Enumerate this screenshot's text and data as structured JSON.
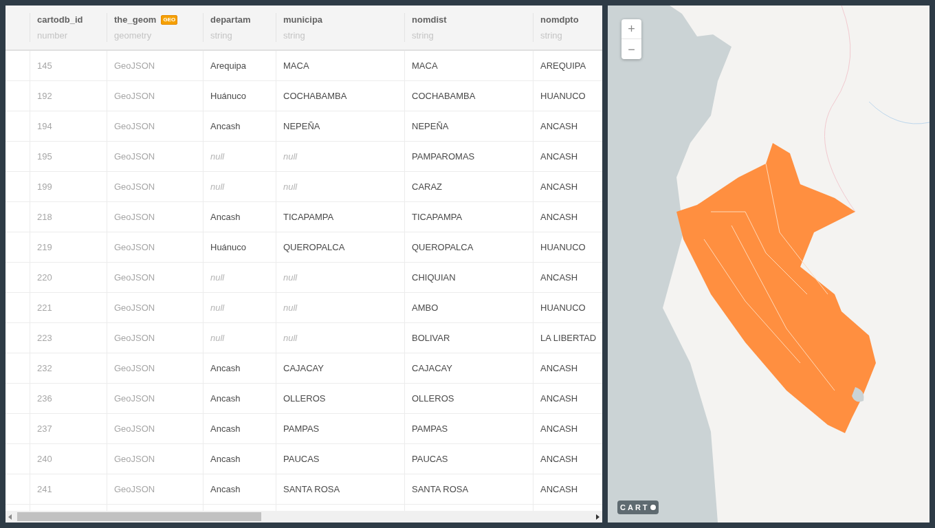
{
  "table": {
    "columns": [
      {
        "name": "cartodb_id",
        "type": "number"
      },
      {
        "name": "the_geom",
        "type": "geometry",
        "badge": "GEO"
      },
      {
        "name": "departam",
        "type": "string"
      },
      {
        "name": "municipa",
        "type": "string"
      },
      {
        "name": "nomdist",
        "type": "string"
      },
      {
        "name": "nomdpto",
        "type": "string"
      }
    ],
    "rows": [
      [
        {
          "text": "145",
          "kind": "number"
        },
        {
          "text": "GeoJSON",
          "kind": "geometry"
        },
        {
          "text": "Arequipa",
          "kind": "string"
        },
        {
          "text": "MACA",
          "kind": "string"
        },
        {
          "text": "MACA",
          "kind": "string"
        },
        {
          "text": "AREQUIPA",
          "kind": "string"
        }
      ],
      [
        {
          "text": "192",
          "kind": "number"
        },
        {
          "text": "GeoJSON",
          "kind": "geometry"
        },
        {
          "text": "Huánuco",
          "kind": "string"
        },
        {
          "text": "COCHABAMBA",
          "kind": "string"
        },
        {
          "text": "COCHABAMBA",
          "kind": "string"
        },
        {
          "text": "HUANUCO",
          "kind": "string"
        }
      ],
      [
        {
          "text": "194",
          "kind": "number"
        },
        {
          "text": "GeoJSON",
          "kind": "geometry"
        },
        {
          "text": "Ancash",
          "kind": "string"
        },
        {
          "text": "NEPEÑA",
          "kind": "string"
        },
        {
          "text": "NEPEÑA",
          "kind": "string"
        },
        {
          "text": "ANCASH",
          "kind": "string"
        }
      ],
      [
        {
          "text": "195",
          "kind": "number"
        },
        {
          "text": "GeoJSON",
          "kind": "geometry"
        },
        {
          "text": "null",
          "kind": "null"
        },
        {
          "text": "null",
          "kind": "null"
        },
        {
          "text": "PAMPAROMAS",
          "kind": "string"
        },
        {
          "text": "ANCASH",
          "kind": "string"
        }
      ],
      [
        {
          "text": "199",
          "kind": "number"
        },
        {
          "text": "GeoJSON",
          "kind": "geometry"
        },
        {
          "text": "null",
          "kind": "null"
        },
        {
          "text": "null",
          "kind": "null"
        },
        {
          "text": "CARAZ",
          "kind": "string"
        },
        {
          "text": "ANCASH",
          "kind": "string"
        }
      ],
      [
        {
          "text": "218",
          "kind": "number"
        },
        {
          "text": "GeoJSON",
          "kind": "geometry"
        },
        {
          "text": "Ancash",
          "kind": "string"
        },
        {
          "text": "TICAPAMPA",
          "kind": "string"
        },
        {
          "text": "TICAPAMPA",
          "kind": "string"
        },
        {
          "text": "ANCASH",
          "kind": "string"
        }
      ],
      [
        {
          "text": "219",
          "kind": "number"
        },
        {
          "text": "GeoJSON",
          "kind": "geometry"
        },
        {
          "text": "Huánuco",
          "kind": "string"
        },
        {
          "text": "QUEROPALCA",
          "kind": "string"
        },
        {
          "text": "QUEROPALCA",
          "kind": "string"
        },
        {
          "text": "HUANUCO",
          "kind": "string"
        }
      ],
      [
        {
          "text": "220",
          "kind": "number"
        },
        {
          "text": "GeoJSON",
          "kind": "geometry"
        },
        {
          "text": "null",
          "kind": "null"
        },
        {
          "text": "null",
          "kind": "null"
        },
        {
          "text": "CHIQUIAN",
          "kind": "string"
        },
        {
          "text": "ANCASH",
          "kind": "string"
        }
      ],
      [
        {
          "text": "221",
          "kind": "number"
        },
        {
          "text": "GeoJSON",
          "kind": "geometry"
        },
        {
          "text": "null",
          "kind": "null"
        },
        {
          "text": "null",
          "kind": "null"
        },
        {
          "text": "AMBO",
          "kind": "string"
        },
        {
          "text": "HUANUCO",
          "kind": "string"
        }
      ],
      [
        {
          "text": "223",
          "kind": "number"
        },
        {
          "text": "GeoJSON",
          "kind": "geometry"
        },
        {
          "text": "null",
          "kind": "null"
        },
        {
          "text": "null",
          "kind": "null"
        },
        {
          "text": "BOLIVAR",
          "kind": "string"
        },
        {
          "text": "LA LIBERTAD",
          "kind": "string"
        }
      ],
      [
        {
          "text": "232",
          "kind": "number"
        },
        {
          "text": "GeoJSON",
          "kind": "geometry"
        },
        {
          "text": "Ancash",
          "kind": "string"
        },
        {
          "text": "CAJACAY",
          "kind": "string"
        },
        {
          "text": "CAJACAY",
          "kind": "string"
        },
        {
          "text": "ANCASH",
          "kind": "string"
        }
      ],
      [
        {
          "text": "236",
          "kind": "number"
        },
        {
          "text": "GeoJSON",
          "kind": "geometry"
        },
        {
          "text": "Ancash",
          "kind": "string"
        },
        {
          "text": "OLLEROS",
          "kind": "string"
        },
        {
          "text": "OLLEROS",
          "kind": "string"
        },
        {
          "text": "ANCASH",
          "kind": "string"
        }
      ],
      [
        {
          "text": "237",
          "kind": "number"
        },
        {
          "text": "GeoJSON",
          "kind": "geometry"
        },
        {
          "text": "Ancash",
          "kind": "string"
        },
        {
          "text": "PAMPAS",
          "kind": "string"
        },
        {
          "text": "PAMPAS",
          "kind": "string"
        },
        {
          "text": "ANCASH",
          "kind": "string"
        }
      ],
      [
        {
          "text": "240",
          "kind": "number"
        },
        {
          "text": "GeoJSON",
          "kind": "geometry"
        },
        {
          "text": "Ancash",
          "kind": "string"
        },
        {
          "text": "PAUCAS",
          "kind": "string"
        },
        {
          "text": "PAUCAS",
          "kind": "string"
        },
        {
          "text": "ANCASH",
          "kind": "string"
        }
      ],
      [
        {
          "text": "241",
          "kind": "number"
        },
        {
          "text": "GeoJSON",
          "kind": "geometry"
        },
        {
          "text": "Ancash",
          "kind": "string"
        },
        {
          "text": "SANTA ROSA",
          "kind": "string"
        },
        {
          "text": "SANTA ROSA",
          "kind": "string"
        },
        {
          "text": "ANCASH",
          "kind": "string"
        }
      ]
    ]
  },
  "map": {
    "zoom_in": "+",
    "zoom_out": "−",
    "attribution": "CART"
  }
}
